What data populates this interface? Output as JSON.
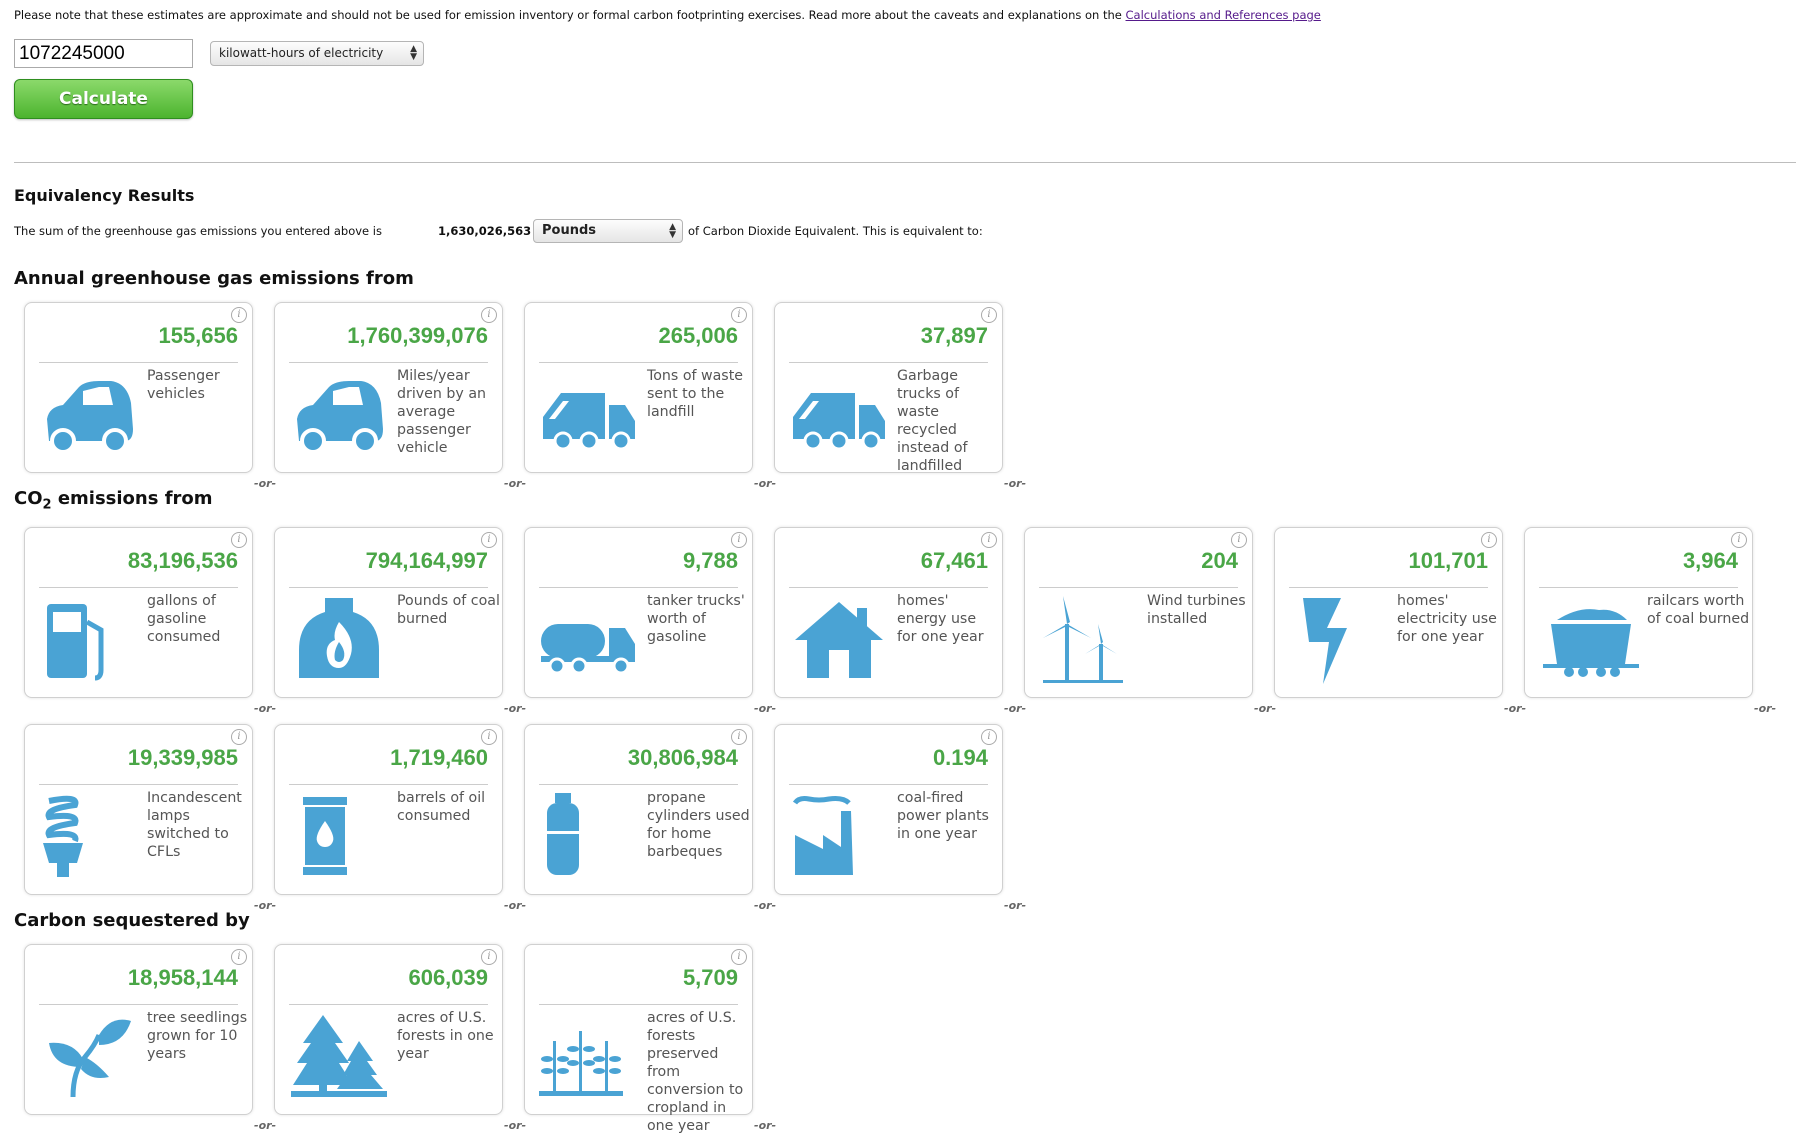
{
  "notice": {
    "text": "Please note that these estimates are approximate and should not be used for emission inventory or formal carbon footprinting exercises. Read more about the caveats and explanations on the ",
    "link": "Calculations and References page"
  },
  "input": {
    "amount": "1072245000",
    "unit": "kilowatt-hours of electricity",
    "calculate_label": "Calculate"
  },
  "results": {
    "title": "Equivalency Results",
    "sum_prefix": "The sum of the greenhouse gas emissions you entered above is",
    "sum_value": "1,630,026,563",
    "sum_unit": "Pounds",
    "sum_suffix": "of Carbon Dioxide Equivalent. This is equivalent to:"
  },
  "sections": {
    "annual": "Annual greenhouse gas emissions from",
    "co2_prefix": "CO",
    "co2_sub": "2",
    "co2_suffix": " emissions from",
    "sequestered": "Carbon sequestered by"
  },
  "or_label": "-or-",
  "info_label": "i",
  "cards": {
    "annual": [
      {
        "value": "155,656",
        "desc": "Passenger vehicles",
        "icon": "car-icon"
      },
      {
        "value": "1,760,399,076",
        "desc": "Miles/year driven by an average passenger vehicle",
        "icon": "car-icon"
      },
      {
        "value": "265,006",
        "desc": "Tons of waste sent to the landfill",
        "icon": "garbage-truck-icon"
      },
      {
        "value": "37,897",
        "desc": "Garbage trucks of waste recycled instead of landfilled",
        "icon": "garbage-truck-icon"
      }
    ],
    "co2_row1": [
      {
        "value": "83,196,536",
        "desc": "gallons of gasoline consumed",
        "icon": "gas-pump-icon"
      },
      {
        "value": "794,164,997",
        "desc": "Pounds of coal burned",
        "icon": "furnace-fire-icon"
      },
      {
        "value": "9,788",
        "desc": "tanker trucks' worth of gasoline",
        "icon": "tanker-truck-icon"
      },
      {
        "value": "67,461",
        "desc": "homes' energy use for one year",
        "icon": "house-icon"
      },
      {
        "value": "204",
        "desc": "Wind turbines installed",
        "icon": "wind-turbine-icon"
      },
      {
        "value": "101,701",
        "desc": "homes' electricity use for one year",
        "icon": "lightning-bolt-icon"
      },
      {
        "value": "3,964",
        "desc": "railcars worth of coal burned",
        "icon": "railcar-icon"
      }
    ],
    "co2_row2": [
      {
        "value": "19,339,985",
        "desc": "Incandescent lamps switched to CFLs",
        "icon": "cfl-bulb-icon"
      },
      {
        "value": "1,719,460",
        "desc": "barrels of oil consumed",
        "icon": "oil-barrel-icon"
      },
      {
        "value": "30,806,984",
        "desc": "propane cylinders used for home barbeques",
        "icon": "propane-cylinder-icon"
      },
      {
        "value": "0.194",
        "desc": "coal-fired power plants in one year",
        "icon": "power-plant-icon"
      }
    ],
    "sequestered": [
      {
        "value": "18,958,144",
        "desc": "tree seedlings grown for 10 years",
        "icon": "seedling-icon"
      },
      {
        "value": "606,039",
        "desc": "acres of U.S. forests in one year",
        "icon": "forest-icon"
      },
      {
        "value": "5,709",
        "desc": "acres of U.S. forests preserved from conversion to cropland in one year",
        "icon": "crops-icon"
      }
    ]
  },
  "colors": {
    "accent_green": "#4aa647",
    "icon_blue": "#4aa3d4"
  }
}
